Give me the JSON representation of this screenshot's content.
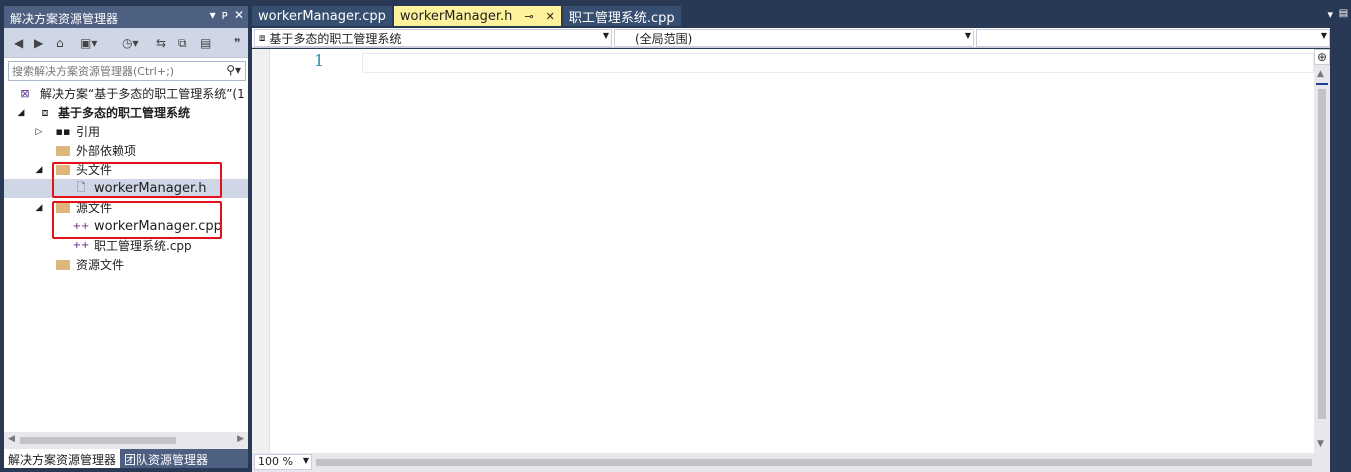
{
  "solution_explorer": {
    "title": "解决方案资源管理器",
    "title_buttons": [
      "▾",
      "ᴘ",
      "✕"
    ],
    "search_placeholder": "搜索解决方案资源管理器(Ctrl+;)",
    "tree": [
      {
        "label": "解决方案“基于多态的职工管理系统”(1",
        "level": 0,
        "icon": "solution-icon",
        "expander": ""
      },
      {
        "label": "基于多态的职工管理系统",
        "level": 0,
        "icon": "project-icon",
        "expander": "◢",
        "bold": true
      },
      {
        "label": "引用",
        "level": 1,
        "icon": "references-icon",
        "expander": "▷"
      },
      {
        "label": "外部依赖项",
        "level": 1,
        "icon": "folder-icon",
        "expander": ""
      },
      {
        "label": "头文件",
        "level": 1,
        "icon": "folder-icon",
        "expander": "◢"
      },
      {
        "label": "workerManager.h",
        "level": 2,
        "icon": "header-file-icon",
        "expander": "",
        "selected": true
      },
      {
        "label": "源文件",
        "level": 1,
        "icon": "folder-icon",
        "expander": "◢"
      },
      {
        "label": "workerManager.cpp",
        "level": 2,
        "icon": "cpp-file-icon",
        "expander": ""
      },
      {
        "label": "职工管理系统.cpp",
        "level": 2,
        "icon": "cpp-file-icon",
        "expander": ""
      },
      {
        "label": "资源文件",
        "level": 1,
        "icon": "folder-icon",
        "expander": ""
      }
    ],
    "bottom_tabs": [
      "解决方案资源管理器",
      "团队资源管理器"
    ]
  },
  "document_tabs": [
    {
      "label": "workerManager.cpp",
      "active": false
    },
    {
      "label": "workerManager.h",
      "active": true
    },
    {
      "label": "职工管理系统.cpp",
      "active": false
    }
  ],
  "nav_bar": {
    "project": "基于多态的职工管理系统",
    "scope": "(全局范围)",
    "member": ""
  },
  "editor": {
    "line_number": "1"
  },
  "status": {
    "zoom": "100 %"
  },
  "colors": {
    "chrome": "#293955",
    "active_tab": "#fff29d",
    "highlight_box": "#e3111a",
    "line_number": "#2b91af"
  }
}
